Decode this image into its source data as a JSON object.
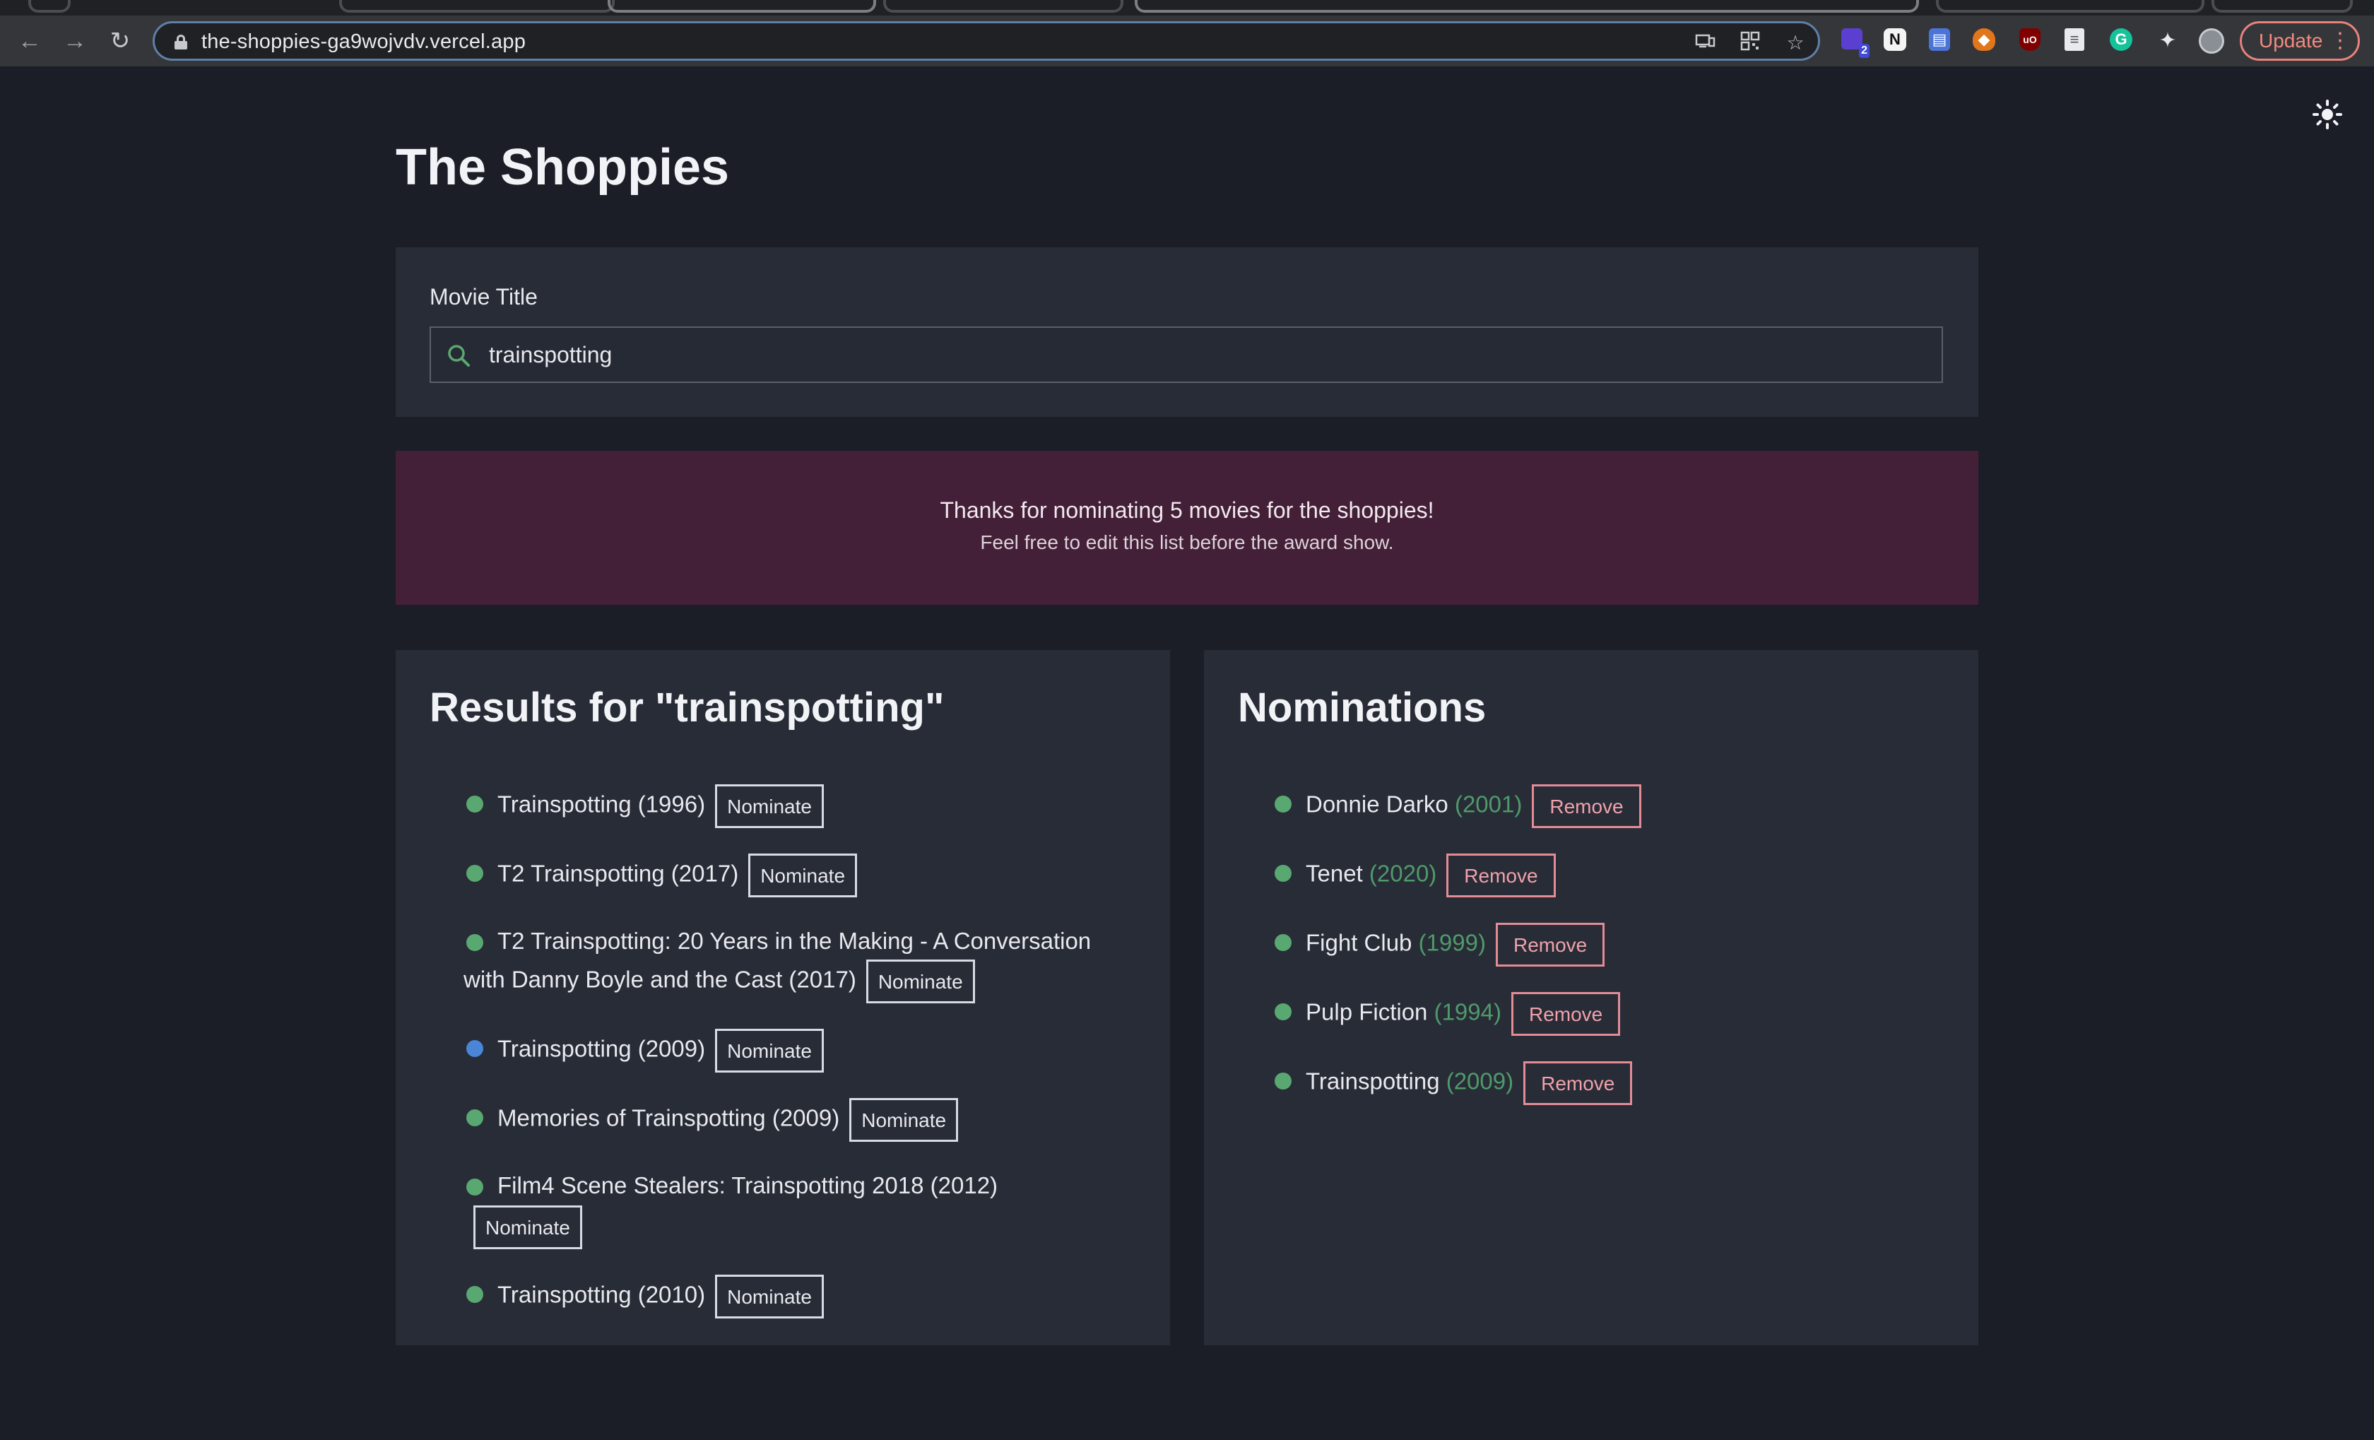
{
  "browser": {
    "url": "the-shoppies-ga9wojvdv.vercel.app",
    "update_label": "Update",
    "extension_badge": "2"
  },
  "app": {
    "title": "The Shoppies"
  },
  "search": {
    "label": "Movie Title",
    "value": "trainspotting"
  },
  "banner": {
    "line1": "Thanks for nominating 5 movies for the shoppies!",
    "line2": "Feel free to edit this list before the award show."
  },
  "results": {
    "heading": "Results for \"trainspotting\"",
    "button_label": "Nominate",
    "items": [
      {
        "title": "Trainspotting (1996)",
        "dot": "green"
      },
      {
        "title": "T2 Trainspotting (2017)",
        "dot": "green"
      },
      {
        "title": "T2 Trainspotting: 20 Years in the Making - A Conversation with Danny Boyle and the Cast (2017)",
        "dot": "green"
      },
      {
        "title": "Trainspotting (2009)",
        "dot": "blue"
      },
      {
        "title": "Memories of Trainspotting (2009)",
        "dot": "green"
      },
      {
        "title": "Film4 Scene Stealers: Trainspotting 2018 (2012)",
        "dot": "green"
      },
      {
        "title": "Trainspotting (2010)",
        "dot": "green"
      }
    ]
  },
  "nominations": {
    "heading": "Nominations",
    "button_label": "Remove",
    "items": [
      {
        "title": "Donnie Darko",
        "year": "(2001)"
      },
      {
        "title": "Tenet",
        "year": "(2020)"
      },
      {
        "title": "Fight Club",
        "year": "(1999)"
      },
      {
        "title": "Pulp Fiction",
        "year": "(1994)"
      },
      {
        "title": "Trainspotting",
        "year": "(2009)"
      }
    ]
  },
  "colors": {
    "page_bg": "#1b1e27",
    "card_bg": "#282c37",
    "banner_bg": "#431f38",
    "dot_green": "#5aa871",
    "dot_blue": "#4a86d8",
    "year_green": "#4f9a6a",
    "remove_border": "#e38c96"
  }
}
